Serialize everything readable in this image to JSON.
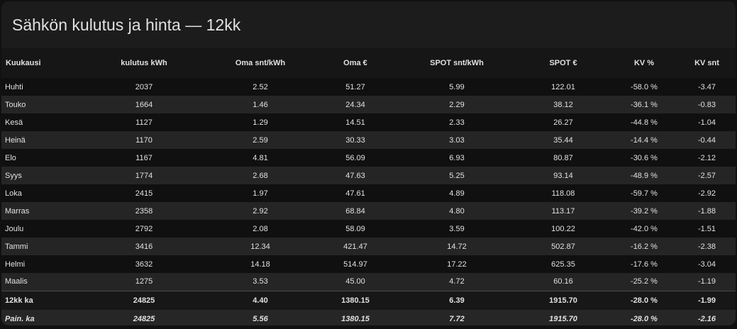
{
  "card": {
    "title": "Sähkön kulutus ja hinta — 12kk"
  },
  "table": {
    "headers": [
      "Kuukausi",
      "kulutus kWh",
      "Oma snt/kWh",
      "Oma €",
      "SPOT snt/kWh",
      "SPOT €",
      "KV %",
      "KV snt"
    ],
    "rows": [
      [
        "Huhti",
        "2037",
        "2.52",
        "51.27",
        "5.99",
        "122.01",
        "-58.0 %",
        "-3.47"
      ],
      [
        "Touko",
        "1664",
        "1.46",
        "24.34",
        "2.29",
        "38.12",
        "-36.1 %",
        "-0.83"
      ],
      [
        "Kesä",
        "1127",
        "1.29",
        "14.51",
        "2.33",
        "26.27",
        "-44.8 %",
        "-1.04"
      ],
      [
        "Heinä",
        "1170",
        "2.59",
        "30.33",
        "3.03",
        "35.44",
        "-14.4 %",
        "-0.44"
      ],
      [
        "Elo",
        "1167",
        "4.81",
        "56.09",
        "6.93",
        "80.87",
        "-30.6 %",
        "-2.12"
      ],
      [
        "Syys",
        "1774",
        "2.68",
        "47.63",
        "5.25",
        "93.14",
        "-48.9 %",
        "-2.57"
      ],
      [
        "Loka",
        "2415",
        "1.97",
        "47.61",
        "4.89",
        "118.08",
        "-59.7 %",
        "-2.92"
      ],
      [
        "Marras",
        "2358",
        "2.92",
        "68.84",
        "4.80",
        "113.17",
        "-39.2 %",
        "-1.88"
      ],
      [
        "Joulu",
        "2792",
        "2.08",
        "58.09",
        "3.59",
        "100.22",
        "-42.0 %",
        "-1.51"
      ],
      [
        "Tammi",
        "3416",
        "12.34",
        "421.47",
        "14.72",
        "502.87",
        "-16.2 %",
        "-2.38"
      ],
      [
        "Helmi",
        "3632",
        "14.18",
        "514.97",
        "17.22",
        "625.35",
        "-17.6 %",
        "-3.04"
      ],
      [
        "Maalis",
        "1275",
        "3.53",
        "45.00",
        "4.72",
        "60.16",
        "-25.2 %",
        "-1.19"
      ]
    ],
    "summary": [
      "12kk ka",
      "24825",
      "4.40",
      "1380.15",
      "6.39",
      "1915.70",
      "-28.0 %",
      "-1.99"
    ],
    "weighted": [
      "Pain. ka",
      "24825",
      "5.56",
      "1380.15",
      "7.72",
      "1915.70",
      "-28.0 %",
      "-2.16"
    ]
  },
  "colors": {
    "background": "#111111",
    "card": "#1c1c1c",
    "row_dark": "#101010",
    "row_light": "#252525",
    "text": "#e1e1e1"
  }
}
